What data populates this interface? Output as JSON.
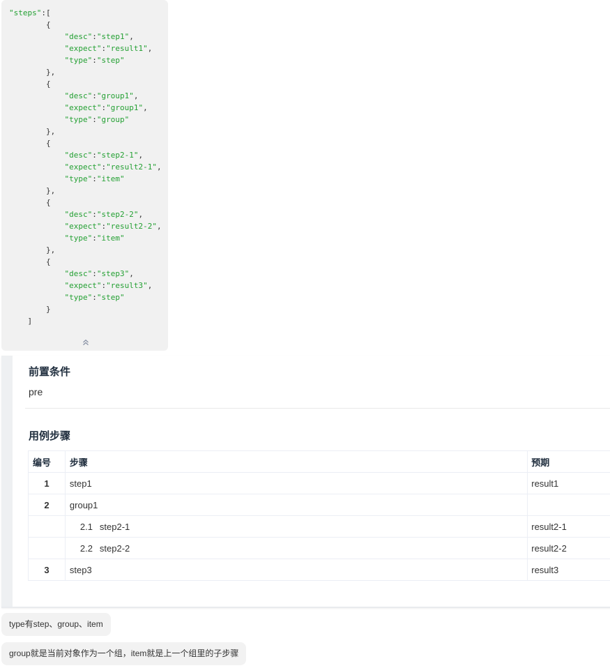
{
  "code": {
    "lines": [
      [
        {
          "t": "\"steps\"",
          "s": true
        },
        {
          "t": ":["
        }
      ],
      [
        {
          "t": "        {"
        }
      ],
      [
        {
          "t": "            "
        },
        {
          "t": "\"desc\"",
          "s": true
        },
        {
          "t": ":"
        },
        {
          "t": "\"step1\"",
          "s": true
        },
        {
          "t": ","
        }
      ],
      [
        {
          "t": "            "
        },
        {
          "t": "\"expect\"",
          "s": true
        },
        {
          "t": ":"
        },
        {
          "t": "\"result1\"",
          "s": true
        },
        {
          "t": ","
        }
      ],
      [
        {
          "t": "            "
        },
        {
          "t": "\"type\"",
          "s": true
        },
        {
          "t": ":"
        },
        {
          "t": "\"step\"",
          "s": true
        }
      ],
      [
        {
          "t": "        },"
        }
      ],
      [
        {
          "t": "        {"
        }
      ],
      [
        {
          "t": "            "
        },
        {
          "t": "\"desc\"",
          "s": true
        },
        {
          "t": ":"
        },
        {
          "t": "\"group1\"",
          "s": true
        },
        {
          "t": ","
        }
      ],
      [
        {
          "t": "            "
        },
        {
          "t": "\"expect\"",
          "s": true
        },
        {
          "t": ":"
        },
        {
          "t": "\"group1\"",
          "s": true
        },
        {
          "t": ","
        }
      ],
      [
        {
          "t": "            "
        },
        {
          "t": "\"type\"",
          "s": true
        },
        {
          "t": ":"
        },
        {
          "t": "\"group\"",
          "s": true
        }
      ],
      [
        {
          "t": "        },"
        }
      ],
      [
        {
          "t": "        {"
        }
      ],
      [
        {
          "t": "            "
        },
        {
          "t": "\"desc\"",
          "s": true
        },
        {
          "t": ":"
        },
        {
          "t": "\"step2-1\"",
          "s": true
        },
        {
          "t": ","
        }
      ],
      [
        {
          "t": "            "
        },
        {
          "t": "\"expect\"",
          "s": true
        },
        {
          "t": ":"
        },
        {
          "t": "\"result2-1\"",
          "s": true
        },
        {
          "t": ","
        }
      ],
      [
        {
          "t": "            "
        },
        {
          "t": "\"type\"",
          "s": true
        },
        {
          "t": ":"
        },
        {
          "t": "\"item\"",
          "s": true
        }
      ],
      [
        {
          "t": "        },"
        }
      ],
      [
        {
          "t": "        {"
        }
      ],
      [
        {
          "t": "            "
        },
        {
          "t": "\"desc\"",
          "s": true
        },
        {
          "t": ":"
        },
        {
          "t": "\"step2-2\"",
          "s": true
        },
        {
          "t": ","
        }
      ],
      [
        {
          "t": "            "
        },
        {
          "t": "\"expect\"",
          "s": true
        },
        {
          "t": ":"
        },
        {
          "t": "\"result2-2\"",
          "s": true
        },
        {
          "t": ","
        }
      ],
      [
        {
          "t": "            "
        },
        {
          "t": "\"type\"",
          "s": true
        },
        {
          "t": ":"
        },
        {
          "t": "\"item\"",
          "s": true
        }
      ],
      [
        {
          "t": "        },"
        }
      ],
      [
        {
          "t": "        {"
        }
      ],
      [
        {
          "t": "            "
        },
        {
          "t": "\"desc\"",
          "s": true
        },
        {
          "t": ":"
        },
        {
          "t": "\"step3\"",
          "s": true
        },
        {
          "t": ","
        }
      ],
      [
        {
          "t": "            "
        },
        {
          "t": "\"expect\"",
          "s": true
        },
        {
          "t": ":"
        },
        {
          "t": "\"result3\"",
          "s": true
        },
        {
          "t": ","
        }
      ],
      [
        {
          "t": "            "
        },
        {
          "t": "\"type\"",
          "s": true
        },
        {
          "t": ":"
        },
        {
          "t": "\"step\"",
          "s": true
        }
      ],
      [
        {
          "t": "        }"
        }
      ],
      [
        {
          "t": "    ]"
        }
      ]
    ],
    "collapse_icon": "double-chevron-up-icon"
  },
  "card": {
    "precondition_title": "前置条件",
    "precondition_text": "pre",
    "steps_title": "用例步骤",
    "table": {
      "headers": {
        "num": "编号",
        "step": "步骤",
        "expect": "预期"
      },
      "rows": [
        {
          "kind": "step",
          "num": "1",
          "step": "step1",
          "expect": "result1"
        },
        {
          "kind": "step",
          "num": "2",
          "step": "group1",
          "expect": ""
        },
        {
          "kind": "item",
          "num": "2.1",
          "step": "step2-1",
          "expect": "result2-1"
        },
        {
          "kind": "item",
          "num": "2.2",
          "step": "step2-2",
          "expect": "result2-2"
        },
        {
          "kind": "step",
          "num": "3",
          "step": "step3",
          "expect": "result3"
        }
      ]
    }
  },
  "messages": [
    "type有step、group、item",
    "group就是当前对象作为一个组，item就是上一个组里的子步骤"
  ]
}
